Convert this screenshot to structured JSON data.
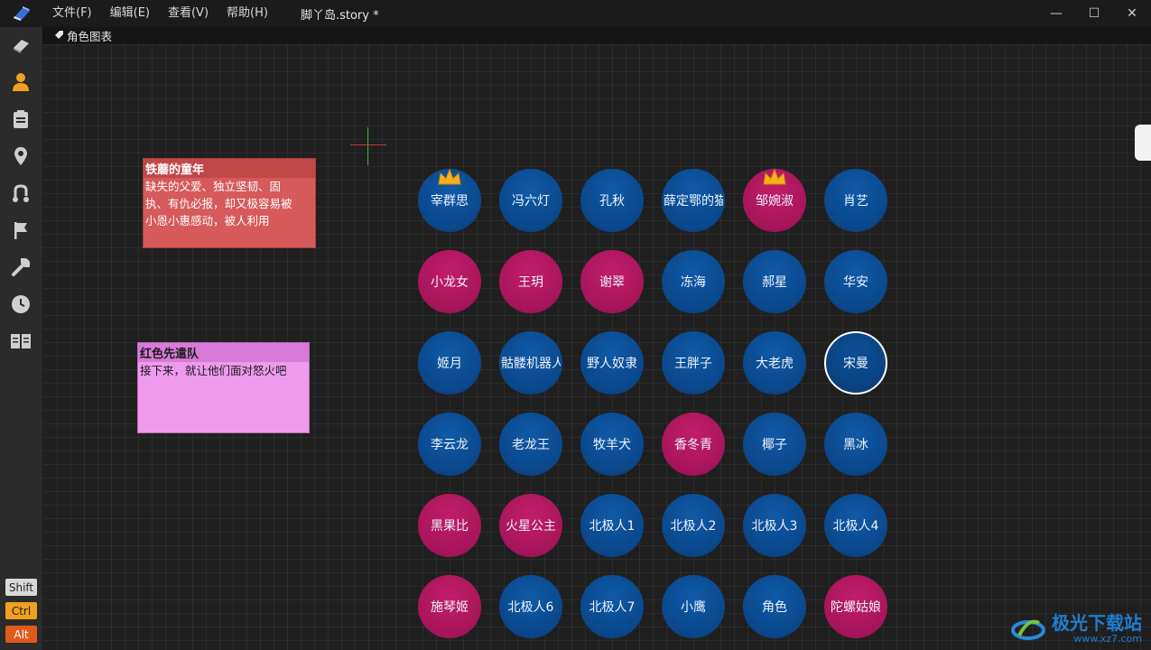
{
  "titlebar": {
    "menus": [
      "文件(F)",
      "编辑(E)",
      "查看(V)",
      "帮助(H)"
    ],
    "document_title": "脚丫岛.story *",
    "controls": {
      "minimize": "—",
      "maximize": "☐",
      "close": "✕"
    }
  },
  "sidebar": {
    "icons": [
      "book-icon",
      "person-icon",
      "clipboard-icon",
      "location-pin-icon",
      "route-icon",
      "flag-icon",
      "wrench-icon",
      "clock-icon",
      "open-book-icon"
    ],
    "active": "person-icon",
    "active_color": "#f0a020",
    "modifier_keys": {
      "shift": "Shift",
      "ctrl": "Ctrl",
      "alt": "Alt"
    }
  },
  "tab": {
    "label": "角色图表",
    "icon": "tag-icon"
  },
  "notes": [
    {
      "title": "铁蘑的童年",
      "body_lines": [
        "缺失的父爱、独立坚韧、固",
        "执、有仇必报，却又极容易被",
        "小恩小惠感动，被人利用"
      ],
      "color": "#d65a5a"
    },
    {
      "title": "红色先遣队",
      "body_lines": [
        "接下来，就让他们面对怒火吧"
      ],
      "color": "#ee9bee"
    }
  ],
  "characters": [
    [
      {
        "name": "宰群思",
        "color": "blue",
        "crown": true
      },
      {
        "name": "冯六灯",
        "color": "blue"
      },
      {
        "name": "孔秋",
        "color": "blue"
      },
      {
        "name": "薛定鄂的猫",
        "color": "blue"
      },
      {
        "name": "邹婉淑",
        "color": "pink",
        "crown": true
      },
      {
        "name": "肖艺",
        "color": "blue"
      }
    ],
    [
      {
        "name": "小龙女",
        "color": "pink"
      },
      {
        "name": "王玥",
        "color": "pink"
      },
      {
        "name": "谢翠",
        "color": "pink"
      },
      {
        "name": "冻海",
        "color": "blue"
      },
      {
        "name": "郝星",
        "color": "blue"
      },
      {
        "name": "华安",
        "color": "blue"
      }
    ],
    [
      {
        "name": "姬月",
        "color": "blue"
      },
      {
        "name": "骷髅机器人",
        "color": "blue"
      },
      {
        "name": "野人奴隶",
        "color": "blue"
      },
      {
        "name": "王胖子",
        "color": "blue"
      },
      {
        "name": "大老虎",
        "color": "blue"
      },
      {
        "name": "宋曼",
        "color": "blue",
        "selected": true
      }
    ],
    [
      {
        "name": "李云龙",
        "color": "blue"
      },
      {
        "name": "老龙王",
        "color": "blue"
      },
      {
        "name": "牧羊犬",
        "color": "blue"
      },
      {
        "name": "香冬青",
        "color": "pink"
      },
      {
        "name": "椰子",
        "color": "blue"
      },
      {
        "name": "黑冰",
        "color": "blue"
      }
    ],
    [
      {
        "name": "黑果比",
        "color": "pink"
      },
      {
        "name": "火星公主",
        "color": "pink"
      },
      {
        "name": "北极人1",
        "color": "blue"
      },
      {
        "name": "北极人2",
        "color": "blue"
      },
      {
        "name": "北极人3",
        "color": "blue"
      },
      {
        "name": "北极人4",
        "color": "blue"
      }
    ],
    [
      {
        "name": "施琴姬",
        "color": "pink"
      },
      {
        "name": "北极人6",
        "color": "blue"
      },
      {
        "name": "北极人7",
        "color": "blue"
      },
      {
        "name": "小鹰",
        "color": "blue"
      },
      {
        "name": "角色",
        "color": "blue"
      },
      {
        "name": "陀螺姑娘",
        "color": "pink"
      }
    ]
  ],
  "watermark": {
    "brand": "极光下载站",
    "url": "www.xz7.com"
  }
}
